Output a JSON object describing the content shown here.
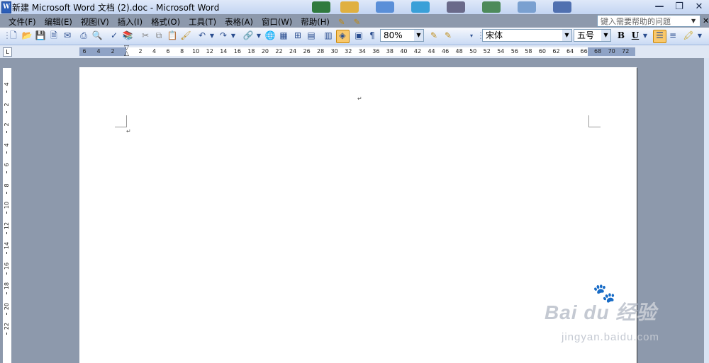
{
  "window": {
    "title": "新建 Microsoft Word 文档 (2).doc - Microsoft Word",
    "controls": [
      "—",
      "❐",
      "✕"
    ]
  },
  "menu": [
    "文件(F)",
    "编辑(E)",
    "视图(V)",
    "插入(I)",
    "格式(O)",
    "工具(T)",
    "表格(A)",
    "窗口(W)",
    "帮助(H)"
  ],
  "help_box": {
    "placeholder": "键入需要帮助的问题"
  },
  "toolbar": {
    "zoom": "80%",
    "font": "宋体",
    "size": "五号",
    "bold_label": "B",
    "underline_label": "U"
  },
  "ruler": {
    "left_labels": [
      "6",
      "4",
      "2"
    ],
    "right_labels": [
      "2",
      "4",
      "6",
      "8",
      "10",
      "12",
      "14",
      "16",
      "18",
      "20",
      "22",
      "24",
      "26",
      "28",
      "30",
      "32",
      "34",
      "36",
      "38",
      "40",
      "42",
      "44",
      "46",
      "48",
      "50",
      "52",
      "54",
      "56",
      "58",
      "60",
      "62",
      "64",
      "66",
      "68",
      "70",
      "72"
    ],
    "vertical_labels": [
      "4",
      "2",
      "2",
      "4",
      "6",
      "8",
      "10",
      "12",
      "14",
      "16",
      "18",
      "20",
      "22"
    ]
  },
  "watermark": {
    "brand": "Bai du 经验",
    "url": "jingyan.baidu.com"
  },
  "colors": {
    "accent": "#2b5eb8",
    "toolbar": "#c9daf4",
    "workspace": "#8d99ac"
  }
}
